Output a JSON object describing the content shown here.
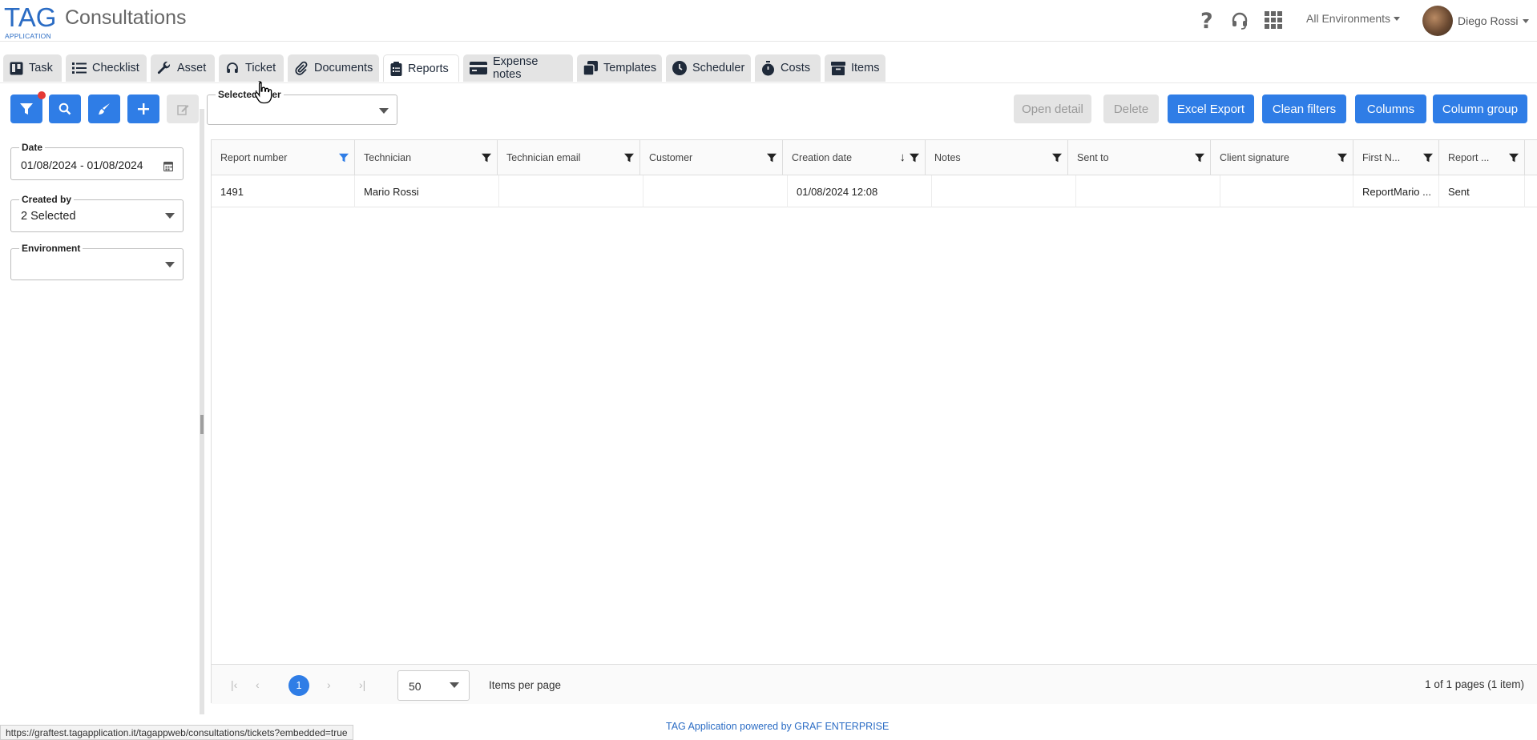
{
  "header": {
    "logo_main": "TAG",
    "logo_sub": "APPLICATION",
    "title": "Consultations",
    "environment": "All Environments",
    "user_name": "Diego Rossi",
    "icons": [
      "help-icon",
      "headset-icon",
      "apps-grid-icon"
    ]
  },
  "tabs": [
    {
      "label": "Task",
      "icon": "kanban-icon"
    },
    {
      "label": "Checklist",
      "icon": "list-icon"
    },
    {
      "label": "Asset",
      "icon": "wrench-icon"
    },
    {
      "label": "Ticket",
      "icon": "headset-icon"
    },
    {
      "label": "Documents",
      "icon": "paperclip-icon"
    },
    {
      "label": "Reports",
      "icon": "clipboard-icon",
      "active": true
    },
    {
      "label": "Expense notes",
      "icon": "credit-card-icon"
    },
    {
      "label": "Templates",
      "icon": "copy-icon"
    },
    {
      "label": "Scheduler",
      "icon": "clock-icon"
    },
    {
      "label": "Costs",
      "icon": "stopwatch-icon"
    },
    {
      "label": "Items",
      "icon": "box-icon"
    }
  ],
  "toolbar": {
    "selected_filter_label": "Selected filter",
    "selected_filter_value": "",
    "open_detail": "Open detail",
    "delete": "Delete",
    "excel_export": "Excel Export",
    "clean_filters": "Clean filters",
    "columns": "Columns",
    "column_group": "Column group"
  },
  "filters": {
    "date_label": "Date",
    "date_value": "01/08/2024 - 01/08/2024",
    "created_by_label": "Created by",
    "created_by_value": "2 Selected",
    "environment_label": "Environment",
    "environment_value": ""
  },
  "grid": {
    "columns": [
      "Report number",
      "Technician",
      "Technician email",
      "Customer",
      "Creation date",
      "Notes",
      "Sent to",
      "Client signature",
      "First N...",
      "Report ..."
    ],
    "rows": [
      [
        "1491",
        "Mario Rossi",
        "",
        "",
        "01/08/2024 12:08",
        "",
        "",
        "",
        "ReportMario ...",
        "Sent"
      ]
    ]
  },
  "pager": {
    "current_page": "1",
    "page_size": "50",
    "items_per_page_label": "Items per page",
    "info": "1 of 1 pages (1 item)"
  },
  "footer": {
    "status_url": "https://graftest.tagapplication.it/tagappweb/consultations/tickets?embedded=true",
    "powered_by": "TAG Application powered by GRAF ENTERPRISE"
  },
  "colors": {
    "primary": "#2f7de6",
    "brand": "#2b6cc4",
    "badge": "#e53935"
  }
}
